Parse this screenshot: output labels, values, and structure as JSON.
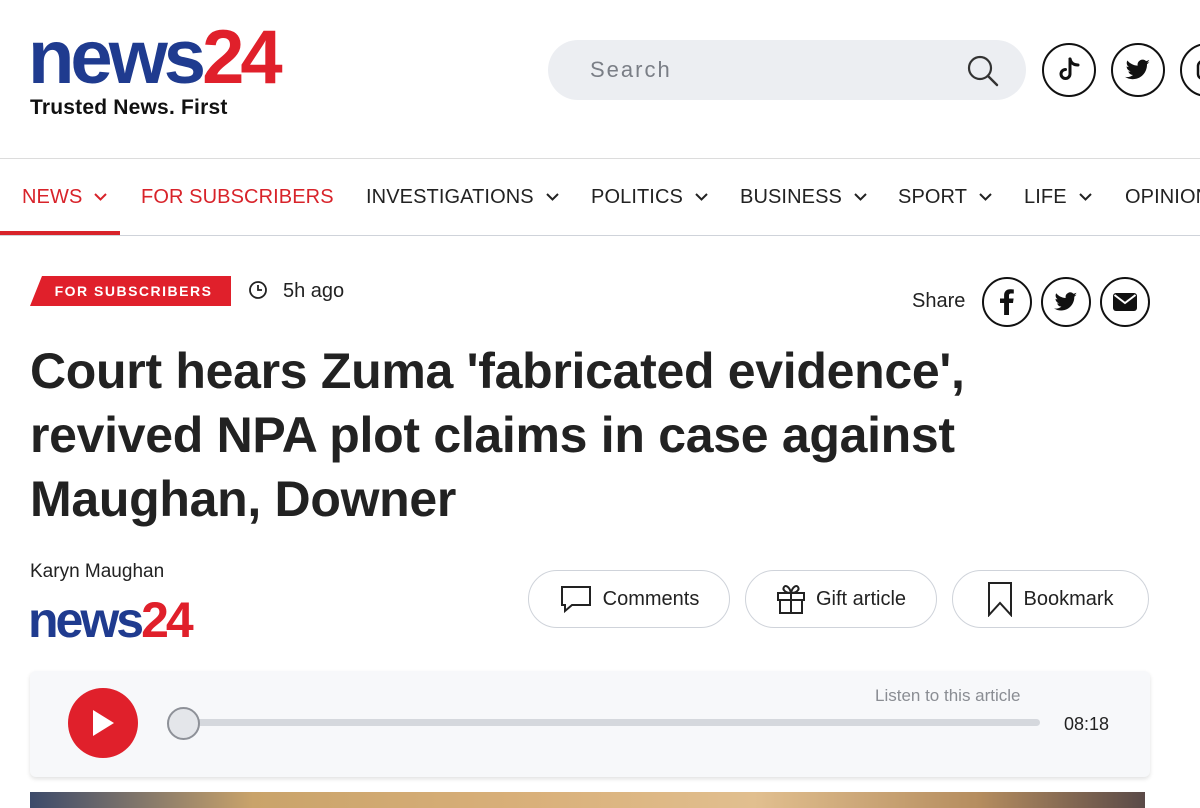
{
  "header": {
    "logo_news": "news",
    "logo_24": "24",
    "tagline": "Trusted News. First",
    "search_placeholder": "Search",
    "social_icons": [
      "tiktok-icon",
      "twitter-icon",
      "instagram-icon"
    ]
  },
  "nav": {
    "items": [
      {
        "label": "NEWS",
        "has_dropdown": true,
        "active": true
      },
      {
        "label": "FOR SUBSCRIBERS",
        "has_dropdown": false,
        "active": false
      },
      {
        "label": "INVESTIGATIONS",
        "has_dropdown": true,
        "active": false
      },
      {
        "label": "POLITICS",
        "has_dropdown": true,
        "active": false
      },
      {
        "label": "BUSINESS",
        "has_dropdown": true,
        "active": false
      },
      {
        "label": "SPORT",
        "has_dropdown": true,
        "active": false
      },
      {
        "label": "LIFE",
        "has_dropdown": true,
        "active": false
      },
      {
        "label": "OPINION",
        "has_dropdown": false,
        "active": false
      }
    ]
  },
  "article": {
    "badge": "FOR SUBSCRIBERS",
    "time_ago": "5h ago",
    "share_label": "Share",
    "share_icons": [
      "facebook-icon",
      "twitter-icon",
      "email-icon"
    ],
    "headline": "Court hears Zuma 'fabricated evidence', revived NPA plot claims in case against Maughan, Downer",
    "author": "Karyn Maughan",
    "publisher_news": "news",
    "publisher_24": "24",
    "actions": {
      "comments": "Comments",
      "gift": "Gift article",
      "bookmark": "Bookmark"
    }
  },
  "player": {
    "listen_label": "Listen to this article",
    "duration": "08:18",
    "progress": 0
  },
  "colors": {
    "brand_blue": "#1f3b8f",
    "brand_red": "#e0202b",
    "nav_red": "#d8232a"
  }
}
